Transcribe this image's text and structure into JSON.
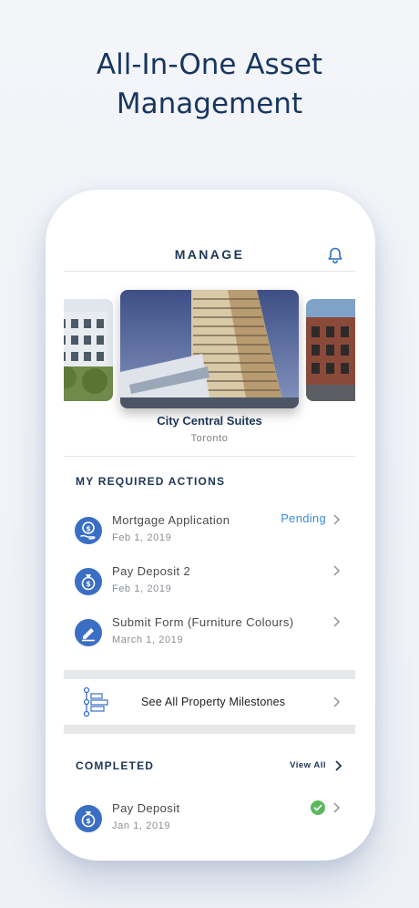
{
  "headline": {
    "line1": "All-In-One Asset",
    "line2": "Management"
  },
  "header": {
    "title": "MANAGE",
    "icon": "bell-icon"
  },
  "property": {
    "name": "City Central Suites",
    "city": "Toronto"
  },
  "required": {
    "heading": "MY REQUIRED ACTIONS",
    "items": [
      {
        "label": "Mortgage Application",
        "date": "Feb 1, 2019",
        "status": "Pending",
        "icon": "dollar-hand-icon"
      },
      {
        "label": "Pay Deposit 2",
        "date": "Feb 1, 2019",
        "status": "",
        "icon": "money-bag-icon"
      },
      {
        "label": "Submit Form (Furniture Colours)",
        "date": "March 1, 2019",
        "status": "",
        "icon": "pencil-icon"
      }
    ]
  },
  "milestones": {
    "label": "See All Property Milestones",
    "icon": "timeline-icon"
  },
  "completed": {
    "heading": "COMPLETED",
    "view_all": "View All",
    "items": [
      {
        "label": "Pay Deposit",
        "date": "Jan 1, 2019",
        "icon": "money-bag-icon",
        "status_icon": "check-circle-icon"
      }
    ]
  },
  "colors": {
    "brand": "#1d3557",
    "accent": "#3b6fc4",
    "pending": "#3c8bd9",
    "success": "#5cb85c"
  }
}
